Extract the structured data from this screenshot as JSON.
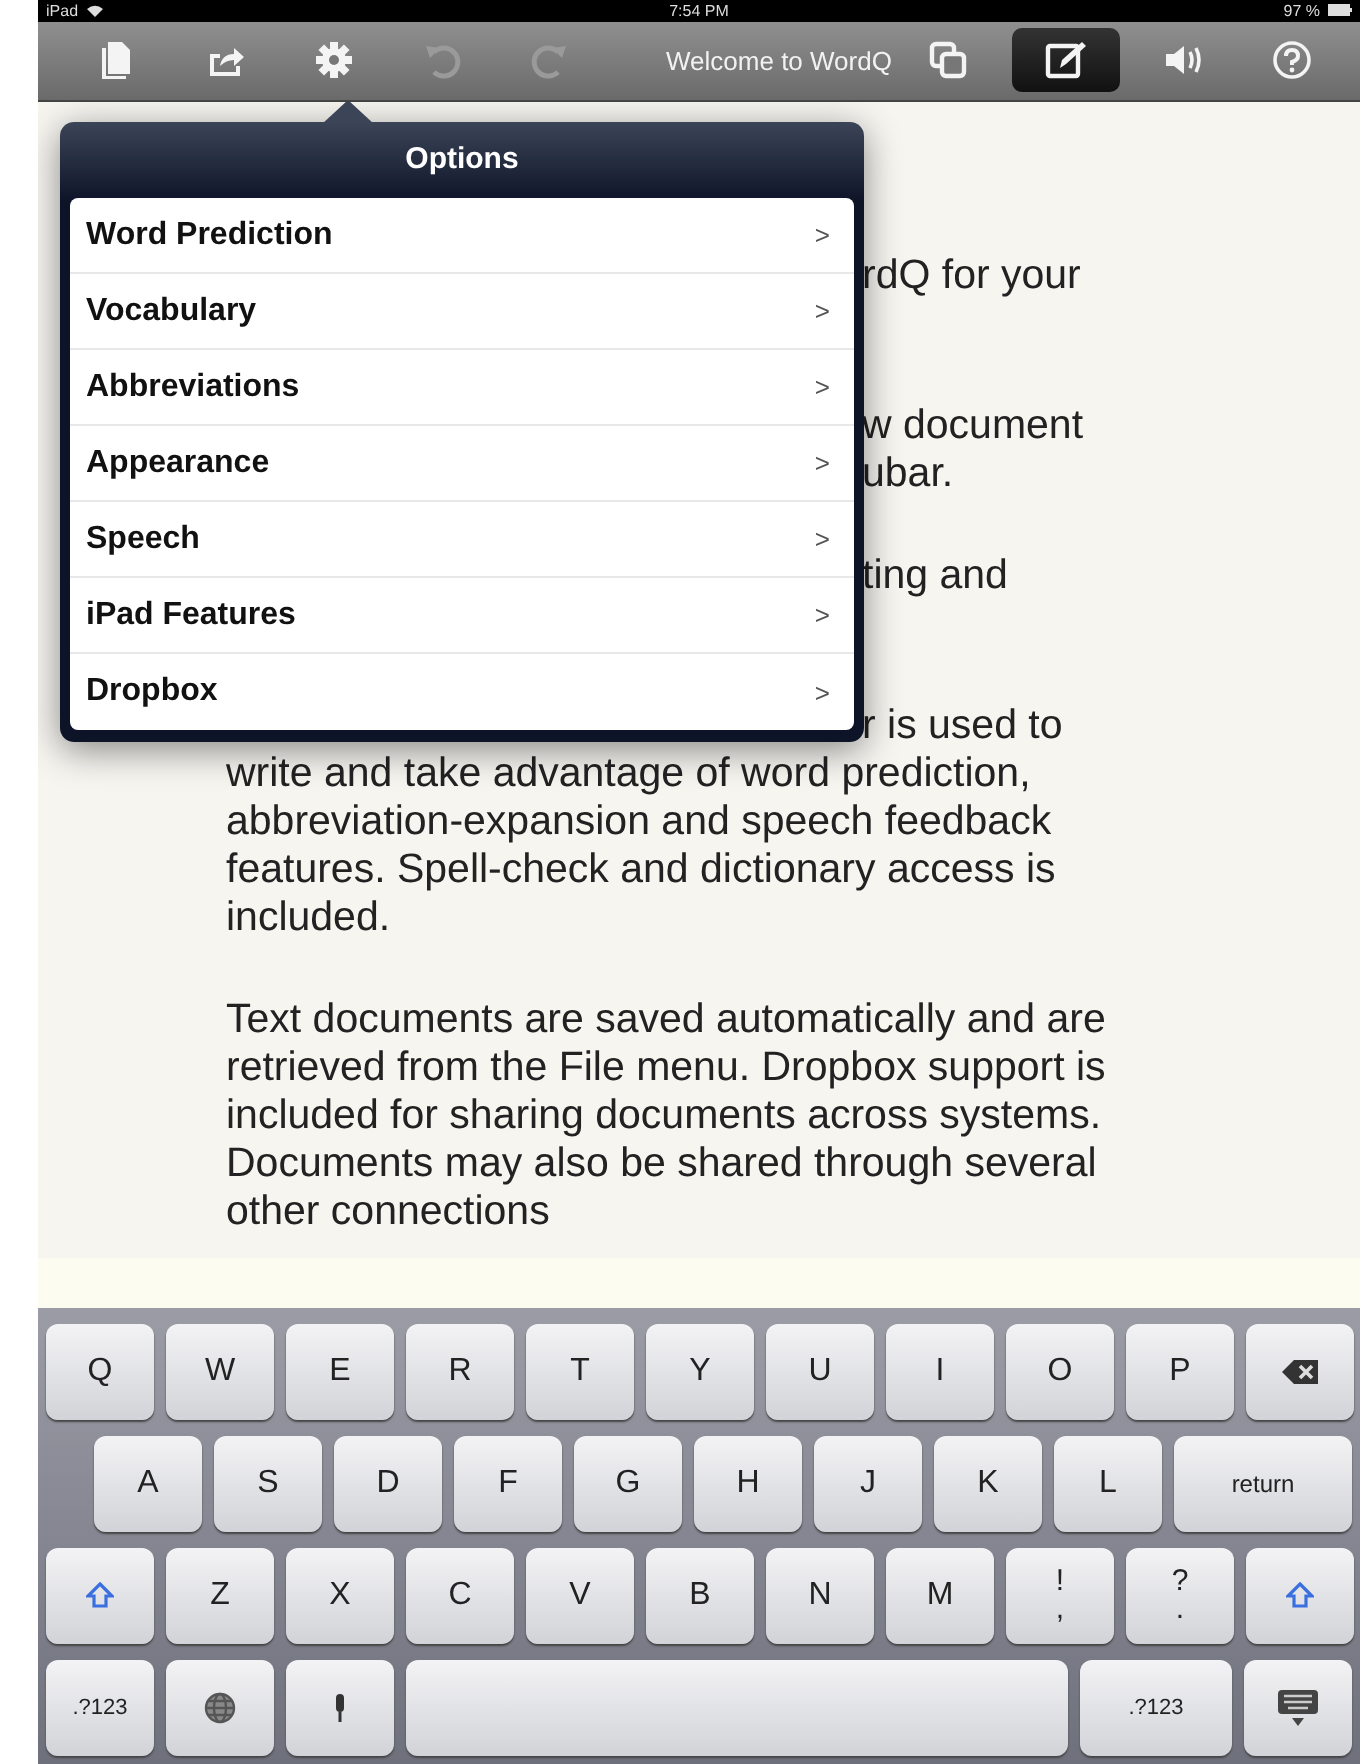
{
  "status_bar": {
    "device": "iPad",
    "time": "7:54 PM",
    "battery": "97 %"
  },
  "toolbar": {
    "title": "Welcome to WordQ",
    "left": [
      {
        "kind": "document",
        "disabled": false,
        "selected": false
      },
      {
        "kind": "share",
        "disabled": false,
        "selected": false
      },
      {
        "kind": "settings",
        "disabled": false,
        "selected": false
      },
      {
        "kind": "undo",
        "disabled": true,
        "selected": false
      },
      {
        "kind": "redo",
        "disabled": true,
        "selected": false
      }
    ],
    "right": [
      {
        "kind": "copy",
        "disabled": false,
        "selected": false
      },
      {
        "kind": "compose",
        "disabled": false,
        "selected": true
      },
      {
        "kind": "speaker",
        "disabled": false,
        "selected": false
      },
      {
        "kind": "help",
        "disabled": false,
        "selected": false
      }
    ]
  },
  "popover": {
    "title": "Options",
    "items": [
      {
        "label": "Word Prediction",
        "chevron": ">"
      },
      {
        "label": "Vocabulary",
        "chevron": ">"
      },
      {
        "label": "Abbreviations",
        "chevron": ">"
      },
      {
        "label": "Appearance",
        "chevron": ">"
      },
      {
        "label": "Speech",
        "chevron": ">"
      },
      {
        "label": "iPad Features",
        "chevron": ">"
      },
      {
        "label": "Dropbox",
        "chevron": ">"
      }
    ]
  },
  "document": {
    "paragraphs": [
      {
        "partial": true,
        "lines": [
          "rdQ for your"
        ]
      },
      {
        "partial": true,
        "lines": [
          "w document",
          "ubar."
        ]
      },
      {
        "partial": true,
        "lines": [
          "ting and"
        ]
      },
      {
        "partial": false,
        "lead": "r is used to",
        "lines": [
          "write and take advantage of word prediction,",
          "abbreviation-expansion and speech feedback",
          "features. Spell-check and dictionary access is",
          "included."
        ]
      },
      {
        "partial": false,
        "lines": [
          "Text documents are saved automatically and are",
          "retrieved from the File menu. Dropbox support is",
          "included for sharing documents across systems.",
          "Documents may also be shared through several",
          "other connections"
        ]
      }
    ]
  },
  "keyboard": {
    "rows": [
      {
        "keys": [
          {
            "kind": "char",
            "label": "Q"
          },
          {
            "kind": "char",
            "label": "W"
          },
          {
            "kind": "char",
            "label": "E"
          },
          {
            "kind": "char",
            "label": "R"
          },
          {
            "kind": "char",
            "label": "T"
          },
          {
            "kind": "char",
            "label": "Y"
          },
          {
            "kind": "char",
            "label": "U"
          },
          {
            "kind": "char",
            "label": "I"
          },
          {
            "kind": "char",
            "label": "O"
          },
          {
            "kind": "char",
            "label": "P"
          },
          {
            "kind": "backspace"
          }
        ]
      },
      {
        "keys": [
          {
            "kind": "char",
            "label": "A"
          },
          {
            "kind": "char",
            "label": "S"
          },
          {
            "kind": "char",
            "label": "D"
          },
          {
            "kind": "char",
            "label": "F"
          },
          {
            "kind": "char",
            "label": "G"
          },
          {
            "kind": "char",
            "label": "H"
          },
          {
            "kind": "char",
            "label": "J"
          },
          {
            "kind": "char",
            "label": "K"
          },
          {
            "kind": "char",
            "label": "L"
          },
          {
            "kind": "return",
            "label": "return"
          }
        ]
      },
      {
        "keys": [
          {
            "kind": "shift"
          },
          {
            "kind": "char",
            "label": "Z"
          },
          {
            "kind": "char",
            "label": "X"
          },
          {
            "kind": "char",
            "label": "C"
          },
          {
            "kind": "char",
            "label": "V"
          },
          {
            "kind": "char",
            "label": "B"
          },
          {
            "kind": "char",
            "label": "N"
          },
          {
            "kind": "char",
            "label": "M"
          },
          {
            "kind": "dual",
            "top": "!",
            "bottom": ","
          },
          {
            "kind": "dual",
            "top": "?",
            "bottom": "."
          },
          {
            "kind": "shift"
          }
        ]
      },
      {
        "keys": [
          {
            "kind": "mode",
            "label": ".?123"
          },
          {
            "kind": "globe"
          },
          {
            "kind": "mic"
          },
          {
            "kind": "space"
          },
          {
            "kind": "mode",
            "label": ".?123"
          },
          {
            "kind": "hide"
          }
        ]
      }
    ]
  }
}
